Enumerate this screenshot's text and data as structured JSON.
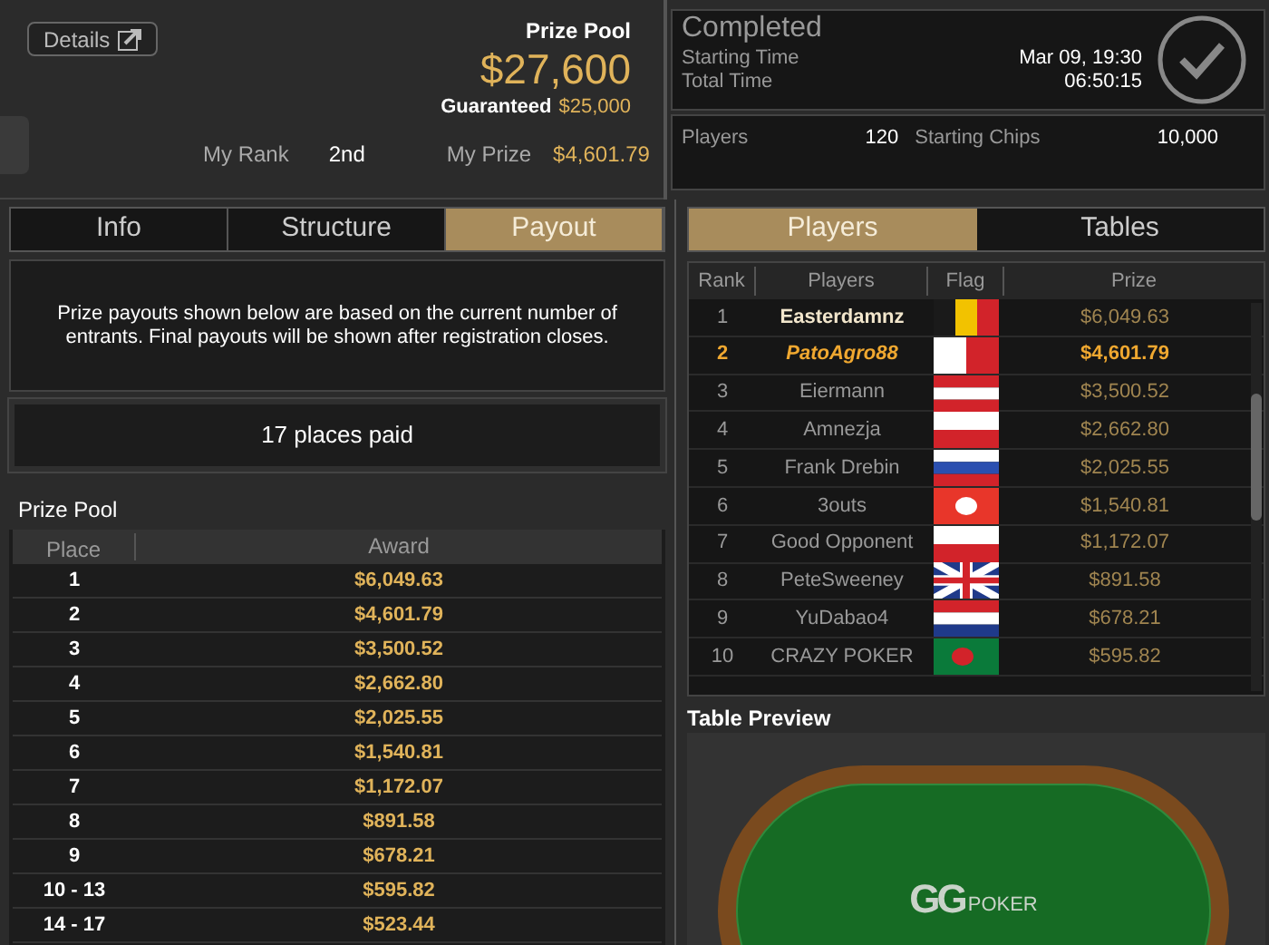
{
  "header": {
    "details_button": "Details",
    "prize_pool_label": "Prize Pool",
    "prize_pool": "$27,600",
    "guaranteed_label": "Guaranteed",
    "guaranteed": "$25,000",
    "my_rank_label": "My Rank",
    "my_rank": "2nd",
    "my_prize_label": "My Prize",
    "my_prize": "$4,601.79"
  },
  "status": {
    "title": "Completed",
    "completed": true,
    "rows": [
      {
        "label": "Starting Time",
        "value": "Mar 09, 19:30"
      },
      {
        "label": "Total Time",
        "value": "06:50:15"
      }
    ],
    "players_label": "Players",
    "players": "120",
    "chips_label": "Starting Chips",
    "chips": "10,000"
  },
  "left_tabs": [
    {
      "label": "Info",
      "selected": false
    },
    {
      "label": "Structure",
      "selected": false
    },
    {
      "label": "Payout",
      "selected": true
    }
  ],
  "notice": "Prize payouts shown below are based on the current number of entrants. Final payouts will be shown after registration closes.",
  "places_paid": "17 places paid",
  "payout_table": {
    "title": "Prize Pool",
    "columns": [
      "Place",
      "Award"
    ],
    "rows": [
      {
        "place": "1",
        "award": "$6,049.63"
      },
      {
        "place": "2",
        "award": "$4,601.79"
      },
      {
        "place": "3",
        "award": "$3,500.52"
      },
      {
        "place": "4",
        "award": "$2,662.80"
      },
      {
        "place": "5",
        "award": "$2,025.55"
      },
      {
        "place": "6",
        "award": "$1,540.81"
      },
      {
        "place": "7",
        "award": "$1,172.07"
      },
      {
        "place": "8",
        "award": "$891.58"
      },
      {
        "place": "9",
        "award": "$678.21"
      },
      {
        "place": "10 - 13",
        "award": "$595.82"
      },
      {
        "place": "14 - 17",
        "award": "$523.44"
      }
    ]
  },
  "right_tabs": [
    {
      "label": "Players",
      "selected": true
    },
    {
      "label": "Tables",
      "selected": false
    }
  ],
  "players_table": {
    "columns": [
      "Rank",
      "Players",
      "Flag",
      "Prize"
    ],
    "rows": [
      {
        "rank": "1",
        "name": "Easterdamnz",
        "kind": "winner",
        "prize": "$6,049.63"
      },
      {
        "rank": "2",
        "name": "PatoAgro88",
        "kind": "self",
        "prize": "$4,601.79"
      },
      {
        "rank": "3",
        "name": "Eiermann",
        "kind": "normal",
        "prize": "$3,500.52"
      },
      {
        "rank": "4",
        "name": "Amnezja",
        "kind": "normal",
        "prize": "$2,662.80"
      },
      {
        "rank": "5",
        "name": "Frank Drebin",
        "kind": "normal",
        "prize": "$2,025.55"
      },
      {
        "rank": "6",
        "name": "3outs",
        "kind": "normal",
        "prize": "$1,540.81"
      },
      {
        "rank": "7",
        "name": "Good Opponent",
        "kind": "normal",
        "prize": "$1,172.07"
      },
      {
        "rank": "8",
        "name": "PeteSweeney",
        "kind": "normal",
        "prize": "$891.58"
      },
      {
        "rank": "9",
        "name": "YuDabao4",
        "kind": "normal",
        "prize": "$678.21"
      },
      {
        "rank": "10",
        "name": "CRAZY POKER",
        "kind": "normal",
        "prize": "$595.82"
      }
    ]
  },
  "table_preview": {
    "title": "Table Preview",
    "logo_mark": "GG",
    "logo_word": "POKER"
  }
}
